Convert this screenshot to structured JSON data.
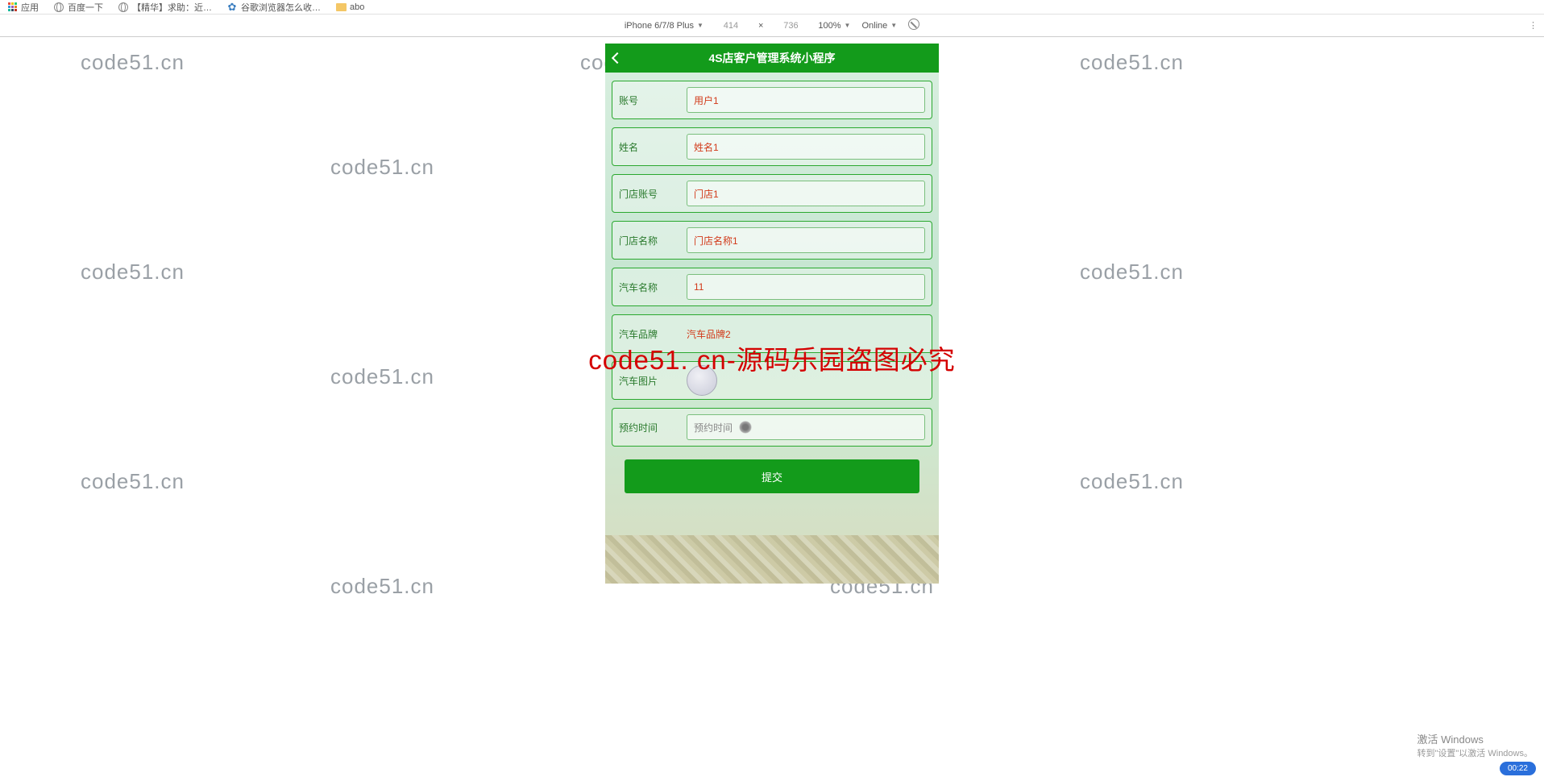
{
  "bookmarks": {
    "apps": "应用",
    "baidu": "百度一下",
    "jinghua": "【精华】求助：近…",
    "guge": "谷歌浏览器怎么收…",
    "abo": "abo"
  },
  "device_toolbar": {
    "device": "iPhone 6/7/8 Plus",
    "width": "414",
    "times": "×",
    "height": "736",
    "zoom": "100%",
    "online": "Online"
  },
  "app": {
    "title": "4S店客户管理系统小程序",
    "fields": {
      "account_label": "账号",
      "account_value": "用户1",
      "name_label": "姓名",
      "name_value": "姓名1",
      "store_account_label": "门店账号",
      "store_account_value": "门店1",
      "store_name_label": "门店名称",
      "store_name_value": "门店名称1",
      "car_name_label": "汽车名称",
      "car_name_value": "11",
      "car_brand_label": "汽车品牌",
      "car_brand_value": "汽车品牌2",
      "car_image_label": "汽车图片",
      "appoint_time_label": "预约时间",
      "appoint_time_placeholder": "预约时间"
    },
    "submit": "提交"
  },
  "watermark": {
    "grey": "code51.cn",
    "red": "code51. cn-源码乐园盗图必究"
  },
  "windows": {
    "activate_title": "激活 Windows",
    "activate_sub": "转到\"设置\"以激活 Windows。",
    "clock": "00:22"
  }
}
